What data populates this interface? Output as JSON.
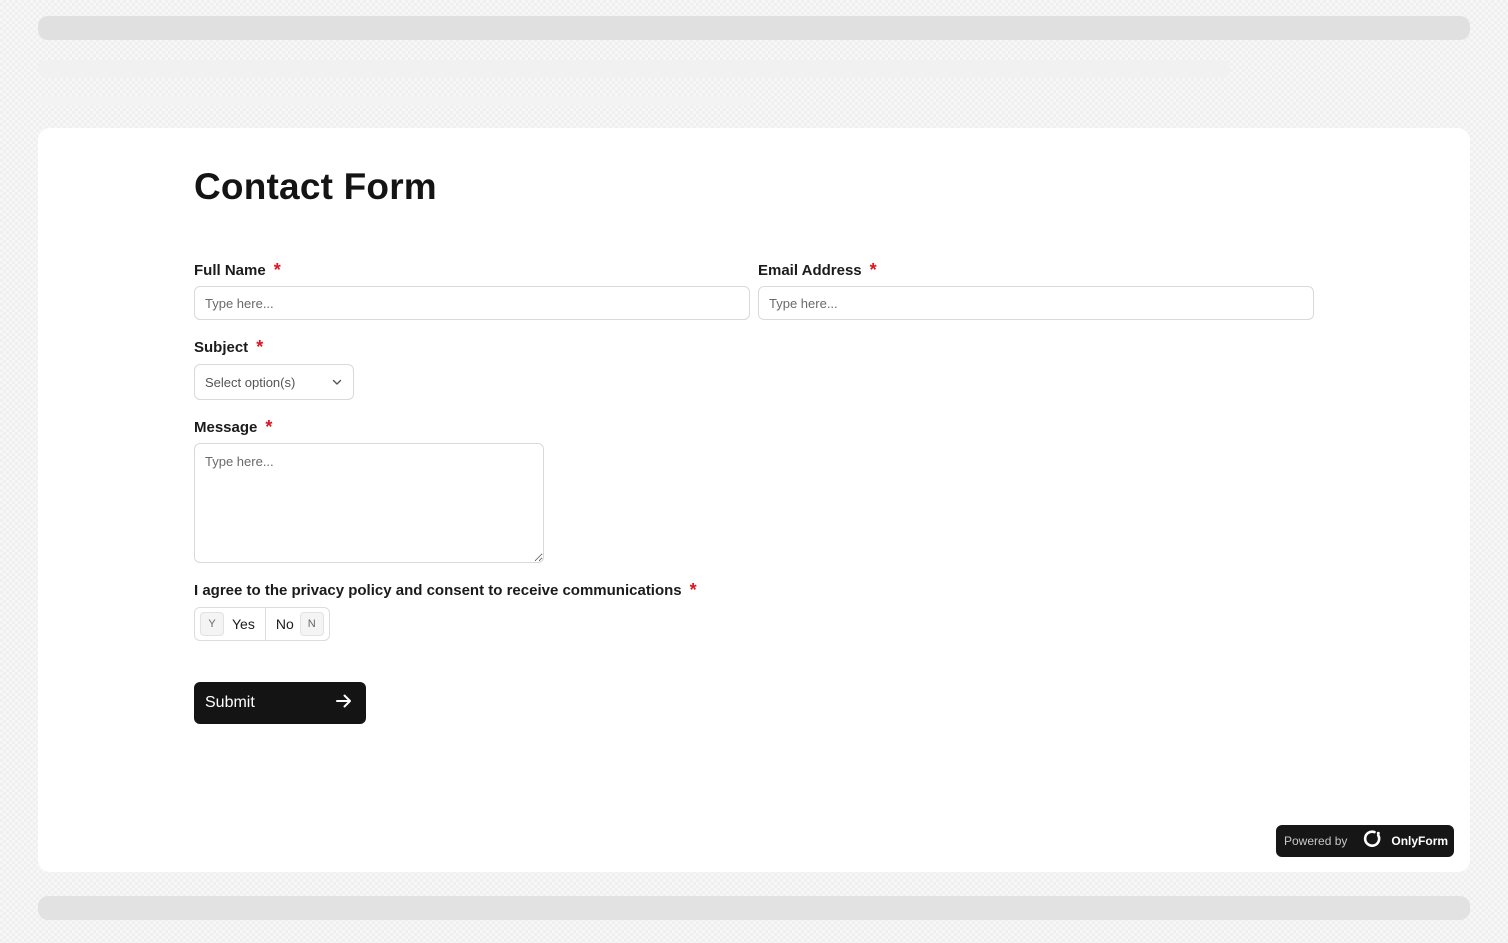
{
  "form": {
    "title": "Contact Form",
    "required_marker": "*",
    "fields": {
      "full_name": {
        "label": "Full Name",
        "placeholder": "Type here..."
      },
      "email": {
        "label": "Email Address",
        "placeholder": "Type here..."
      },
      "subject": {
        "label": "Subject",
        "placeholder": "Select option(s)"
      },
      "message": {
        "label": "Message",
        "placeholder": "Type here..."
      },
      "consent": {
        "label": "I agree to the privacy policy and consent to receive communications",
        "yes_key": "Y",
        "yes_label": "Yes",
        "no_label": "No",
        "no_key": "N"
      }
    },
    "submit_label": "Submit"
  },
  "footer": {
    "powered_by": "Powered by",
    "brand": "OnlyForm"
  },
  "colors": {
    "required": "#e0121e",
    "button_bg": "#141414",
    "badge_bg": "#161616"
  },
  "icons": {
    "subject_dropdown": "chevron-down-icon",
    "submit": "arrow-right-icon",
    "brand": "onlyform-logo-icon"
  }
}
